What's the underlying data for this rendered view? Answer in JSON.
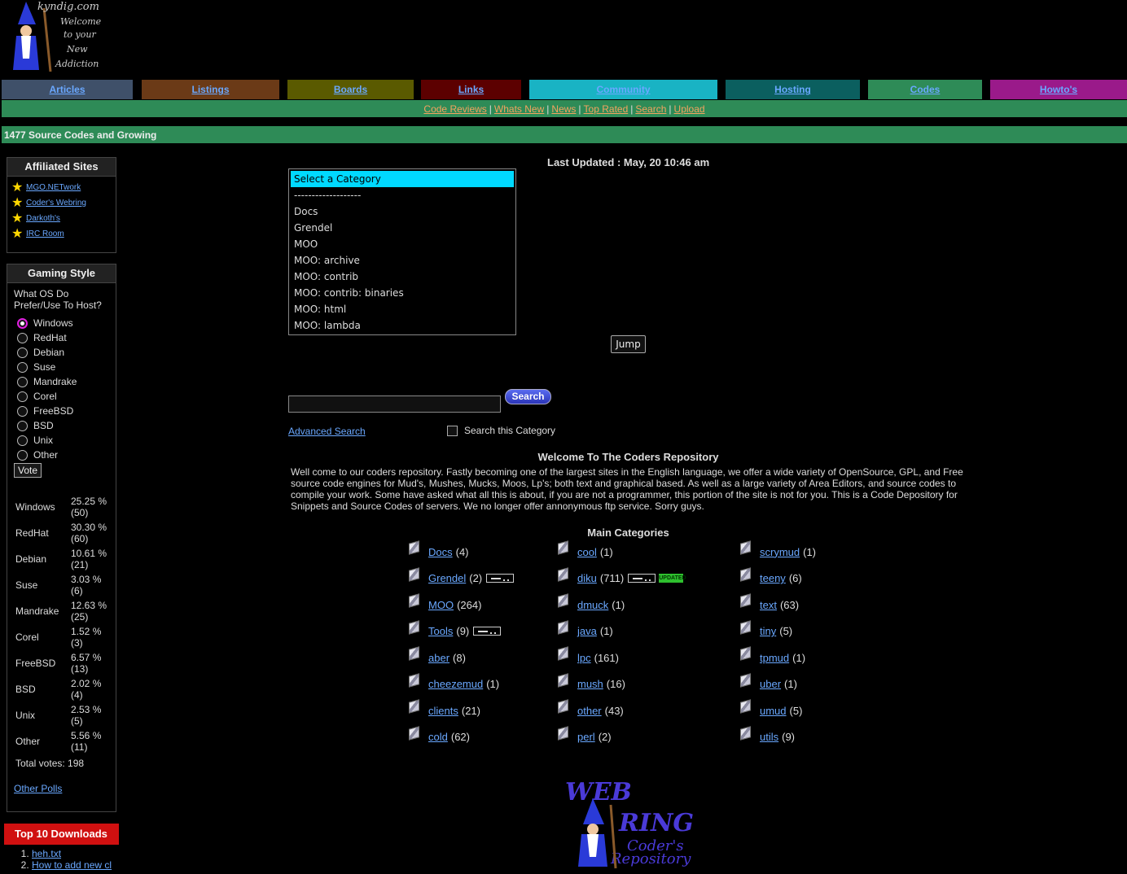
{
  "logo": {
    "text_lines": [
      "kyndig.com",
      "Welcome",
      "to your",
      "New",
      "Addiction"
    ]
  },
  "nav": {
    "tabs": [
      {
        "label": "Articles",
        "color": "#3f5069"
      },
      {
        "label": "Listings",
        "color": "#6b3a17"
      },
      {
        "label": "Boards",
        "color": "#5a5a00"
      },
      {
        "label": "Links",
        "color": "#5c0000"
      },
      {
        "label": "Community",
        "color": "#19b3c4"
      },
      {
        "label": "Hosting",
        "color": "#0b5f5f"
      },
      {
        "label": "Codes",
        "color": "#2e8b57"
      },
      {
        "label": "Howto's",
        "color": "#9a1a8a"
      }
    ]
  },
  "subnav": {
    "links": [
      "Code Reviews",
      "Whats New",
      "News",
      "Top Rated",
      "Search",
      "Upload"
    ]
  },
  "banner": {
    "text": "1477 Source Codes and Growing"
  },
  "affiliated": {
    "title": "Affiliated Sites",
    "items": [
      "MGO.NETwork",
      "Coder's Webring",
      "Darkoth's",
      "IRC Room"
    ]
  },
  "poll": {
    "title": "Gaming Style",
    "question": "What OS Do Prefer/Use To Host?",
    "options": [
      "Windows",
      "RedHat",
      "Debian",
      "Suse",
      "Mandrake",
      "Corel",
      "FreeBSD",
      "BSD",
      "Unix",
      "Other"
    ],
    "selected_index": 0,
    "vote_label": "Vote",
    "results": [
      {
        "name": "Windows",
        "pct": "25.25 % (50)"
      },
      {
        "name": "RedHat",
        "pct": "30.30 % (60)"
      },
      {
        "name": "Debian",
        "pct": "10.61 % (21)"
      },
      {
        "name": "Suse",
        "pct": "3.03 % (6)"
      },
      {
        "name": "Mandrake",
        "pct": "12.63 % (25)"
      },
      {
        "name": "Corel",
        "pct": "1.52 % (3)"
      },
      {
        "name": "FreeBSD",
        "pct": "6.57 % (13)"
      },
      {
        "name": "BSD",
        "pct": "2.02 % (4)"
      },
      {
        "name": "Unix",
        "pct": "2.53 % (5)"
      },
      {
        "name": "Other",
        "pct": "5.56 % (11)"
      }
    ],
    "total": "Total votes: 198",
    "other_polls": "Other Polls"
  },
  "top10": {
    "title": "Top 10 Downloads",
    "items": [
      "heh.txt",
      "How to add new cl"
    ]
  },
  "main": {
    "last_updated": "Last Updated : May, 20 10:46 am",
    "category_list": [
      "Select a Category",
      "-------------------",
      "Docs",
      "Grendel",
      "MOO",
      "MOO: archive",
      "MOO: contrib",
      "MOO: contrib: binaries",
      "MOO: html",
      "MOO: lambda"
    ],
    "jump_label": "Jump",
    "search_label": "Search",
    "advanced_search": "Advanced Search",
    "search_category_label": "Search this Category",
    "welcome_title": "Welcome To The Coders Repository",
    "welcome_text": "Well come to our coders repository. Fastly becoming one of the largest sites in the English language, we offer a wide variety of OpenSource, GPL, and Free source code engines for Mud's, Mushes, Mucks, Moos, Lp's; both text and graphical based. As well as a large variety of Area Editors, and source codes to compile your work. Some have asked what all this is about, if you are not a programmer, this portion of the site is not for you. This is a Code Depository for Snippets and Source Codes of servers. We no longer offer annonymous ftp service. Sorry guys.",
    "main_categories_title": "Main Categories",
    "categories": [
      [
        {
          "name": "Docs",
          "count": "(4)"
        },
        {
          "name": "Grendel",
          "count": "(2)",
          "new": true
        },
        {
          "name": "MOO",
          "count": "(264)"
        },
        {
          "name": "Tools",
          "count": "(9)",
          "new": true
        },
        {
          "name": "aber",
          "count": "(8)"
        },
        {
          "name": "cheezemud",
          "count": "(1)"
        },
        {
          "name": "clients",
          "count": "(21)"
        },
        {
          "name": "cold",
          "count": "(62)"
        }
      ],
      [
        {
          "name": "cool",
          "count": "(1)"
        },
        {
          "name": "diku",
          "count": "(711)",
          "new": true,
          "updated": true
        },
        {
          "name": "dmuck",
          "count": "(1)"
        },
        {
          "name": "java",
          "count": "(1)"
        },
        {
          "name": "lpc",
          "count": "(161)"
        },
        {
          "name": "mush",
          "count": "(16)"
        },
        {
          "name": "other",
          "count": "(43)"
        },
        {
          "name": "perl",
          "count": "(2)"
        }
      ],
      [
        {
          "name": "scrymud",
          "count": "(1)"
        },
        {
          "name": "teeny",
          "count": "(6)"
        },
        {
          "name": "text",
          "count": "(63)"
        },
        {
          "name": "tiny",
          "count": "(5)"
        },
        {
          "name": "tpmud",
          "count": "(1)"
        },
        {
          "name": "uber",
          "count": "(1)"
        },
        {
          "name": "umud",
          "count": "(5)"
        },
        {
          "name": "utils",
          "count": "(9)"
        }
      ]
    ]
  },
  "webring": {
    "lines": [
      "WEB",
      "RING",
      "Coder's",
      "Repository"
    ]
  }
}
